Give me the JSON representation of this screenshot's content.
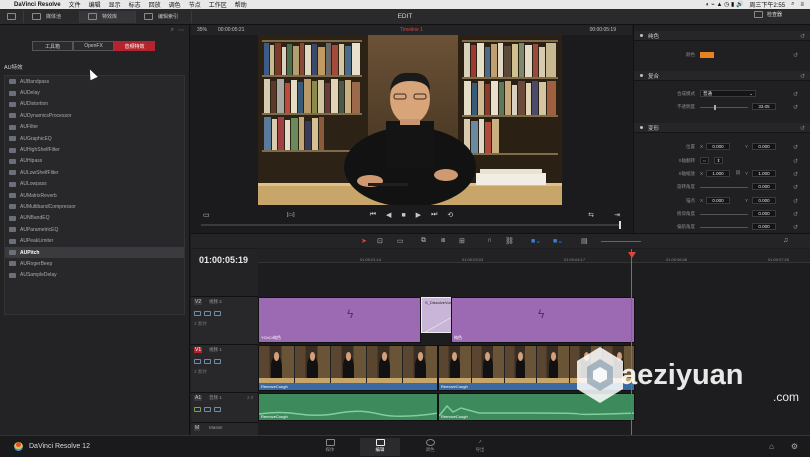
{
  "menubar": {
    "app_name": "DaVinci Resolve",
    "menus": [
      "文件",
      "编辑",
      "显示",
      "标志",
      "回放",
      "调色",
      "节点",
      "工作区",
      "帮助"
    ],
    "clock": "周三下午2:55"
  },
  "toolbar": {
    "media_pool": "媒体池",
    "effects_library": "特效库",
    "edit_index": "编辑索引",
    "page_title": "EDIT",
    "inspector": "检查器"
  },
  "effects_panel": {
    "tabs": [
      "工具箱",
      "OpenFX",
      "音频特效"
    ],
    "active_tab": 2,
    "section_title": "AU特效",
    "items": [
      "AUBandpass",
      "AUDelay",
      "AUDistortion",
      "AUDynamicsProcessor",
      "AUFilter",
      "AUGraphicEQ",
      "AUHighShelfFilter",
      "AUHipass",
      "AULowShelfFilter",
      "AULowpass",
      "AUMatrixReverb",
      "AUMultibandCompressor",
      "AUNBandEQ",
      "AUParametricEQ",
      "AUPeakLimiter",
      "AUPitch",
      "AURogerBeep",
      "AUSampleDelay"
    ],
    "selected_index": 15
  },
  "viewer": {
    "zoom": "35%",
    "source_timecode": "00:00:05:21",
    "timeline_name": "Timeline 1",
    "record_timecode": "00:00:05:19"
  },
  "inspector": {
    "solid_color": {
      "title": "纯色",
      "color_label": "颜色",
      "color_value": "#e8821e"
    },
    "composite": {
      "title": "复合",
      "mode_label": "合成模式",
      "mode_value": "普通",
      "opacity_label": "不透明度",
      "opacity_value": "33.05"
    },
    "transform": {
      "title": "变形",
      "position_label": "位置",
      "position_x": "0.000",
      "position_y": "0.000",
      "flip_label": "X轴翻转",
      "zoom_label": "X轴缩放",
      "zoom_x": "1.000",
      "zoom_y": "1.000",
      "rotation_label": "旋转角度",
      "rotation_value": "0.000",
      "anchor_label": "锚点",
      "anchor_x": "0.000",
      "anchor_y": "0.000",
      "pitch_label": "俯仰角度",
      "pitch_value": "0.000",
      "yaw_label": "偏航角度",
      "yaw_value": "0.000"
    },
    "letters": {
      "x": "X",
      "y": "Y"
    }
  },
  "timeline": {
    "current_timecode": "01:00:05:19",
    "ruler_labels": [
      "01:00:01:14",
      "01:00:03:03",
      "01:00:04:17",
      "01:00:06:06",
      "01:00:07:20"
    ],
    "tracks": [
      {
        "id": "V2",
        "name": "视频 2",
        "sub": "3 素材"
      },
      {
        "id": "V1",
        "name": "视频 1",
        "sub": "3 素材"
      },
      {
        "id": "A1",
        "name": "音频 1",
        "sub": "2.0"
      },
      {
        "id": "M",
        "name": "Master",
        "sub": ""
      }
    ],
    "clips": {
      "v2_clip1": "YCbCr纯色",
      "v2_transition": "S_DissolveVortex",
      "v2_clip2": "纯色",
      "v1_clip1": "RemoveCough",
      "v1_clip2": "RemoveCough",
      "a1_clip1": "RemoveCough",
      "a1_clip2": "RemoveCough"
    },
    "colors": {
      "v2": "#9b6ab2",
      "v1": "#3b6aa0",
      "a1": "#3d8a5c"
    }
  },
  "bottom_bar": {
    "brand": "DaVinci Resolve 12",
    "pages": [
      "媒体",
      "编辑",
      "调色",
      "导出"
    ],
    "active_page": 1
  },
  "watermark": {
    "text": "aeziyuan",
    "suffix": ".com"
  }
}
